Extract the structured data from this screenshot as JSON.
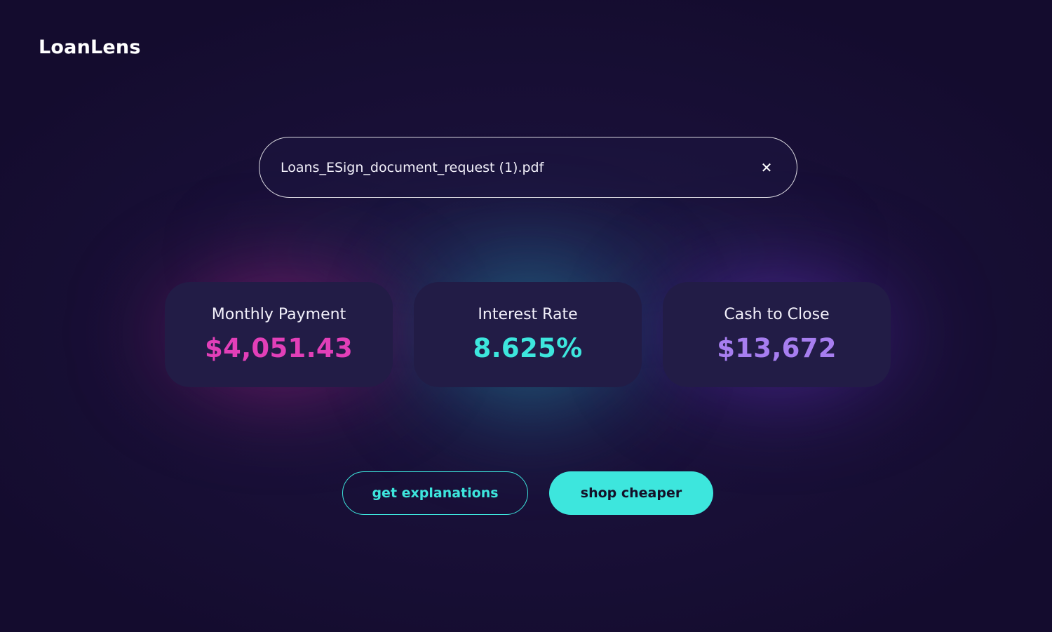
{
  "app": {
    "title": "LoanLens"
  },
  "upload": {
    "file_name": "Loans_ESign_document_request (1).pdf",
    "clear_icon": "close-icon"
  },
  "metrics": [
    {
      "label": "Monthly Payment",
      "value": "$4,051.43",
      "color": "#e23fb8"
    },
    {
      "label": "Interest Rate",
      "value": "8.625%",
      "color": "#3de6dd"
    },
    {
      "label": "Cash to Close",
      "value": "$13,672",
      "color": "#a77ef0"
    }
  ],
  "actions": {
    "explain_label": "get explanations",
    "shop_label": "shop cheaper",
    "accent": "#3de6dd"
  },
  "colors": {
    "background": "#170f33",
    "card": "#221c46"
  }
}
